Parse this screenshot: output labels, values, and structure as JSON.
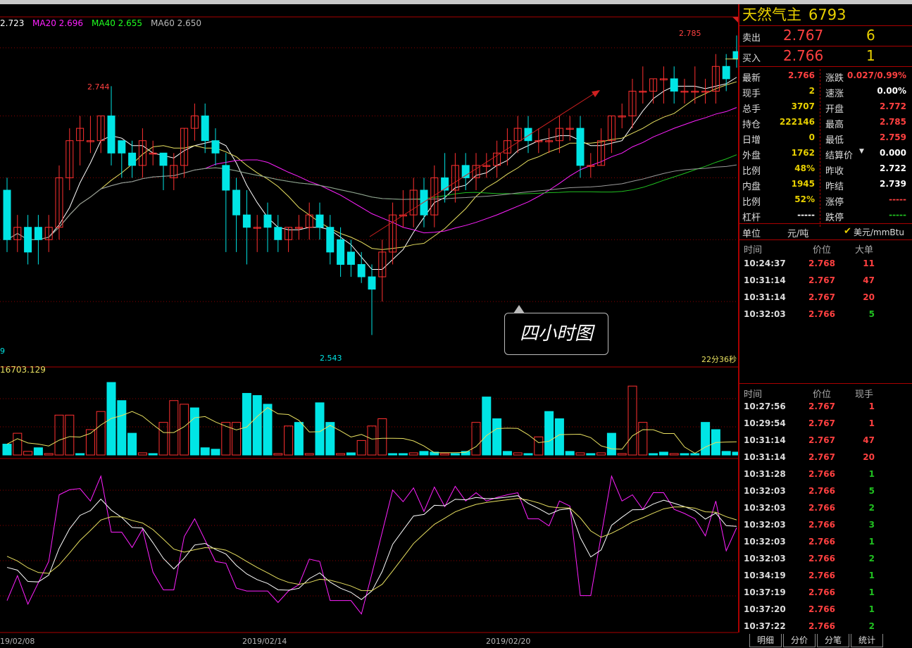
{
  "main_chart": {
    "ma_legend": [
      {
        "text": "2.723",
        "color": "#ffffff"
      },
      {
        "text": "MA20 2.696",
        "color": "#ff20ff"
      },
      {
        "text": "MA40 2.655",
        "color": "#20ff20"
      },
      {
        "text": "MA60 2.650",
        "color": "#b8b8b8"
      }
    ],
    "high_label_left": "2.744",
    "high_label_right": "2.785",
    "low_label": "2.543",
    "left_edge_label": "9",
    "timer": "22分36秒",
    "callout": "四小时图",
    "dates": [
      "19/02/08",
      "2019/02/14",
      "2019/02/20"
    ]
  },
  "volume": {
    "label": "16703.129"
  },
  "chart_data": {
    "type": "candlestick",
    "title": "四小时图",
    "period": "4 hours",
    "y_range": [
      2.52,
      2.8
    ],
    "dates": [
      "19/02/08",
      "2019/02/14",
      "2019/02/20"
    ],
    "candles": [
      [
        2.66,
        2.62,
        2.67,
        2.61
      ],
      [
        2.62,
        2.63,
        2.64,
        2.61
      ],
      [
        2.63,
        2.61,
        2.64,
        2.6
      ],
      [
        2.63,
        2.62,
        2.64,
        2.6
      ],
      [
        2.62,
        2.63,
        2.64,
        2.61
      ],
      [
        2.63,
        2.67,
        2.68,
        2.62
      ],
      [
        2.67,
        2.7,
        2.71,
        2.66
      ],
      [
        2.7,
        2.71,
        2.72,
        2.68
      ],
      [
        2.7,
        2.7,
        2.72,
        2.69
      ],
      [
        2.7,
        2.72,
        2.72,
        2.69
      ],
      [
        2.72,
        2.69,
        2.744,
        2.68
      ],
      [
        2.7,
        2.69,
        2.7,
        2.67
      ],
      [
        2.69,
        2.68,
        2.7,
        2.67
      ],
      [
        2.68,
        2.7,
        2.71,
        2.67
      ],
      [
        2.69,
        2.69,
        2.7,
        2.68
      ],
      [
        2.69,
        2.68,
        2.69,
        2.66
      ],
      [
        2.67,
        2.68,
        2.69,
        2.66
      ],
      [
        2.68,
        2.71,
        2.71,
        2.67
      ],
      [
        2.71,
        2.72,
        2.73,
        2.7
      ],
      [
        2.72,
        2.7,
        2.73,
        2.69
      ],
      [
        2.7,
        2.69,
        2.71,
        2.68
      ],
      [
        2.68,
        2.66,
        2.69,
        2.61
      ],
      [
        2.66,
        2.64,
        2.67,
        2.61
      ],
      [
        2.64,
        2.63,
        2.66,
        2.6
      ],
      [
        2.63,
        2.63,
        2.64,
        2.61
      ],
      [
        2.64,
        2.63,
        2.65,
        2.61
      ],
      [
        2.63,
        2.62,
        2.64,
        2.61
      ],
      [
        2.62,
        2.63,
        2.63,
        2.61
      ],
      [
        2.63,
        2.63,
        2.64,
        2.62
      ],
      [
        2.63,
        2.64,
        2.65,
        2.62
      ],
      [
        2.64,
        2.63,
        2.65,
        2.62
      ],
      [
        2.63,
        2.61,
        2.64,
        2.6
      ],
      [
        2.62,
        2.6,
        2.63,
        2.59
      ],
      [
        2.61,
        2.6,
        2.62,
        2.59
      ],
      [
        2.6,
        2.59,
        2.61,
        2.585
      ],
      [
        2.59,
        2.58,
        2.6,
        2.543
      ],
      [
        2.59,
        2.61,
        2.62,
        2.57
      ],
      [
        2.61,
        2.64,
        2.65,
        2.6
      ],
      [
        2.64,
        2.64,
        2.66,
        2.63
      ],
      [
        2.64,
        2.66,
        2.67,
        2.63
      ],
      [
        2.66,
        2.64,
        2.67,
        2.63
      ],
      [
        2.64,
        2.67,
        2.68,
        2.63
      ],
      [
        2.67,
        2.66,
        2.69,
        2.65
      ],
      [
        2.66,
        2.68,
        2.69,
        2.65
      ],
      [
        2.68,
        2.67,
        2.69,
        2.66
      ],
      [
        2.67,
        2.68,
        2.69,
        2.66
      ],
      [
        2.68,
        2.68,
        2.69,
        2.67
      ],
      [
        2.68,
        2.69,
        2.7,
        2.67
      ],
      [
        2.69,
        2.7,
        2.71,
        2.68
      ],
      [
        2.7,
        2.71,
        2.72,
        2.69
      ],
      [
        2.71,
        2.7,
        2.72,
        2.69
      ],
      [
        2.7,
        2.7,
        2.71,
        2.69
      ],
      [
        2.7,
        2.7,
        2.71,
        2.69
      ],
      [
        2.7,
        2.71,
        2.72,
        2.69
      ],
      [
        2.71,
        2.71,
        2.72,
        2.7
      ],
      [
        2.71,
        2.68,
        2.72,
        2.67
      ],
      [
        2.68,
        2.68,
        2.69,
        2.67
      ],
      [
        2.68,
        2.7,
        2.71,
        2.68
      ],
      [
        2.7,
        2.72,
        2.72,
        2.69
      ],
      [
        2.72,
        2.72,
        2.73,
        2.71
      ],
      [
        2.72,
        2.74,
        2.75,
        2.71
      ],
      [
        2.74,
        2.74,
        2.76,
        2.73
      ],
      [
        2.74,
        2.75,
        2.75,
        2.73
      ],
      [
        2.75,
        2.75,
        2.76,
        2.73
      ],
      [
        2.75,
        2.74,
        2.76,
        2.73
      ],
      [
        2.74,
        2.74,
        2.75,
        2.73
      ],
      [
        2.74,
        2.74,
        2.76,
        2.73
      ],
      [
        2.74,
        2.74,
        2.75,
        2.73
      ],
      [
        2.74,
        2.76,
        2.77,
        2.73
      ],
      [
        2.76,
        2.75,
        2.77,
        2.74
      ],
      [
        2.772,
        2.766,
        2.785,
        2.759
      ]
    ],
    "volume": [
      {
        "v": 0.15,
        "up": false
      },
      {
        "v": 0.3,
        "up": true
      },
      {
        "v": 0.05,
        "up": true
      },
      {
        "v": 0.1,
        "up": false
      },
      {
        "v": 0.02,
        "up": true
      },
      {
        "v": 0.55,
        "up": true
      },
      {
        "v": 0.55,
        "up": true
      },
      {
        "v": 0.02,
        "up": false
      },
      {
        "v": 0.35,
        "up": true
      },
      {
        "v": 0.6,
        "up": true
      },
      {
        "v": 1.0,
        "up": false
      },
      {
        "v": 0.75,
        "up": false
      },
      {
        "v": 0.3,
        "up": false
      },
      {
        "v": 0.03,
        "up": true
      },
      {
        "v": 0.02,
        "up": false
      },
      {
        "v": 0.45,
        "up": true
      },
      {
        "v": 0.75,
        "up": true
      },
      {
        "v": 0.7,
        "up": true
      },
      {
        "v": 0.65,
        "up": false
      },
      {
        "v": 0.1,
        "up": false
      },
      {
        "v": 0.08,
        "up": false
      },
      {
        "v": 0.45,
        "up": true
      },
      {
        "v": 0.45,
        "up": true
      },
      {
        "v": 0.85,
        "up": false
      },
      {
        "v": 0.82,
        "up": false
      },
      {
        "v": 0.7,
        "up": false
      },
      {
        "v": 0.02,
        "up": true
      },
      {
        "v": 0.4,
        "up": true
      },
      {
        "v": 0.45,
        "up": false
      },
      {
        "v": 0.02,
        "up": true
      },
      {
        "v": 0.72,
        "up": false
      },
      {
        "v": 0.45,
        "up": false
      },
      {
        "v": 0.02,
        "up": true
      },
      {
        "v": 0.03,
        "up": false
      },
      {
        "v": 0.2,
        "up": true
      },
      {
        "v": 0.4,
        "up": true
      },
      {
        "v": 0.5,
        "up": true
      },
      {
        "v": 0.02,
        "up": false
      },
      {
        "v": 0.02,
        "up": false
      },
      {
        "v": 0.03,
        "up": true
      },
      {
        "v": 0.05,
        "up": false
      },
      {
        "v": 0.04,
        "up": false
      },
      {
        "v": 0.02,
        "up": true
      },
      {
        "v": 0.02,
        "up": false
      },
      {
        "v": 0.05,
        "up": false
      },
      {
        "v": 0.45,
        "up": true
      },
      {
        "v": 0.8,
        "up": false
      },
      {
        "v": 0.5,
        "up": false
      },
      {
        "v": 0.05,
        "up": false
      },
      {
        "v": 0.03,
        "up": true
      },
      {
        "v": 0.02,
        "up": false
      },
      {
        "v": 0.25,
        "up": true
      },
      {
        "v": 0.6,
        "up": false
      },
      {
        "v": 0.5,
        "up": false
      },
      {
        "v": 0.05,
        "up": false
      },
      {
        "v": 0.03,
        "up": true
      },
      {
        "v": 0.02,
        "up": false
      },
      {
        "v": 0.03,
        "up": true
      },
      {
        "v": 0.3,
        "up": false
      },
      {
        "v": 0.02,
        "up": true
      },
      {
        "v": 0.95,
        "up": true
      },
      {
        "v": 0.45,
        "up": true
      },
      {
        "v": 0.02,
        "up": false
      },
      {
        "v": 0.04,
        "up": false
      },
      {
        "v": 0.02,
        "up": true
      },
      {
        "v": 0.02,
        "up": false
      },
      {
        "v": 0.02,
        "up": false
      },
      {
        "v": 0.45,
        "up": false
      },
      {
        "v": 0.35,
        "up": false
      },
      {
        "v": 0.05,
        "up": false
      },
      {
        "v": 0.04,
        "up": false
      }
    ]
  },
  "quote": {
    "name": "天然气主",
    "code": "6793",
    "ask": {
      "label": "卖出",
      "price": "2.767",
      "qty": "6"
    },
    "bid": {
      "label": "买入",
      "price": "2.766",
      "qty": "1"
    },
    "rows": [
      {
        "k1": "最新",
        "v1": "2.766",
        "c1": "red",
        "k2": "涨跌",
        "v2": "0.027/0.99%",
        "c2": "red"
      },
      {
        "k1": "现手",
        "v1": "2",
        "c1": "yel",
        "k2": "速涨",
        "v2": "0.00%",
        "c2": "wht"
      },
      {
        "k1": "总手",
        "v1": "3707",
        "c1": "yel",
        "k2": "开盘",
        "v2": "2.772",
        "c2": "red"
      },
      {
        "k1": "持仓",
        "v1": "222146",
        "c1": "yel",
        "k2": "最高",
        "v2": "2.785",
        "c2": "red"
      },
      {
        "k1": "日增",
        "v1": "0",
        "c1": "yel",
        "k2": "最低",
        "v2": "2.759",
        "c2": "red"
      },
      {
        "k1": "外盘",
        "v1": "1762",
        "c1": "yel",
        "k2": "结算价",
        "v2": "0.000",
        "c2": "wht"
      },
      {
        "k1": "比例",
        "v1": "48%",
        "c1": "yel",
        "k2": "昨收",
        "v2": "2.722",
        "c2": "wht"
      },
      {
        "k1": "内盘",
        "v1": "1945",
        "c1": "yel",
        "k2": "昨结",
        "v2": "2.739",
        "c2": "wht"
      },
      {
        "k1": "比例",
        "v1": "52%",
        "c1": "yel",
        "k2": "涨停",
        "v2": "-----",
        "c2": "red"
      },
      {
        "k1": "杠杆",
        "v1": "-----",
        "c1": "wht",
        "k2": "跌停",
        "v2": "-----",
        "c2": "grn"
      }
    ],
    "unit_label": "单位",
    "unit_value": "元/吨",
    "unit_alt": "美元/mmBtu"
  },
  "big_trades": {
    "headers": [
      "时间",
      "价位",
      "大单"
    ],
    "rows": [
      {
        "time": "10:24:37",
        "price": "2.768",
        "qty": "11",
        "color": "red"
      },
      {
        "time": "10:31:14",
        "price": "2.767",
        "qty": "47",
        "color": "red"
      },
      {
        "time": "10:31:14",
        "price": "2.767",
        "qty": "20",
        "color": "red"
      },
      {
        "time": "10:32:03",
        "price": "2.766",
        "qty": "5",
        "color": "grn"
      }
    ]
  },
  "ticks": {
    "headers": [
      "时间",
      "价位",
      "现手"
    ],
    "rows": [
      {
        "time": "10:27:56",
        "price": "2.767",
        "qty": "1",
        "color": "red"
      },
      {
        "time": "10:29:54",
        "price": "2.767",
        "qty": "1",
        "color": "red"
      },
      {
        "time": "10:31:14",
        "price": "2.767",
        "qty": "47",
        "color": "red"
      },
      {
        "time": "10:31:14",
        "price": "2.767",
        "qty": "20",
        "color": "red"
      },
      {
        "time": "10:31:28",
        "price": "2.766",
        "qty": "1",
        "color": "grn"
      },
      {
        "time": "10:32:03",
        "price": "2.766",
        "qty": "5",
        "color": "grn"
      },
      {
        "time": "10:32:03",
        "price": "2.766",
        "qty": "2",
        "color": "grn"
      },
      {
        "time": "10:32:03",
        "price": "2.766",
        "qty": "3",
        "color": "grn"
      },
      {
        "time": "10:32:03",
        "price": "2.766",
        "qty": "1",
        "color": "grn"
      },
      {
        "time": "10:32:03",
        "price": "2.766",
        "qty": "2",
        "color": "grn"
      },
      {
        "time": "10:34:19",
        "price": "2.766",
        "qty": "1",
        "color": "grn"
      },
      {
        "time": "10:37:19",
        "price": "2.766",
        "qty": "1",
        "color": "grn"
      },
      {
        "time": "10:37:20",
        "price": "2.766",
        "qty": "1",
        "color": "grn"
      },
      {
        "time": "10:37:22",
        "price": "2.766",
        "qty": "2",
        "color": "grn"
      }
    ]
  },
  "tabs": [
    "明细",
    "分价",
    "分笔",
    "统计"
  ],
  "colors": {
    "up": "#ff3030",
    "down": "#00e5e5",
    "grid": "#8b0000",
    "panel_border": "#aa0000"
  }
}
